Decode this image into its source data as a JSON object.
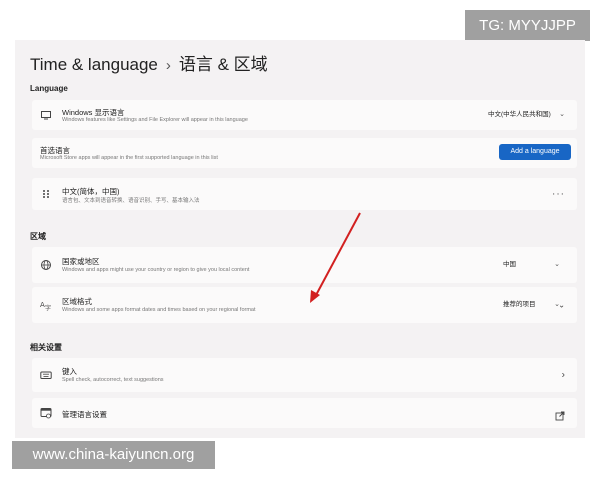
{
  "tg_tag": "TG: MYYJJPP",
  "watermark": "www.china-kaiyuncn.org",
  "title": {
    "parent": "Time & language",
    "separator": "›",
    "current": "语言 & 区域"
  },
  "sections": {
    "language": "Language",
    "region": "区域",
    "related": "相关设置"
  },
  "display_language": {
    "label": "Windows 显示语言",
    "desc": "Windows features like Settings and File Explorer will appear in this language",
    "value": "中文(中华人民共和国)"
  },
  "preferred_languages": {
    "label": "首选语言",
    "desc": "Microsoft Store apps will appear in the first supported language in this list",
    "button": "Add a language"
  },
  "language_item": {
    "label": "中文(简体，中国)",
    "desc": "语言包、文本到语音转换、语音识别、手写、基本输入法",
    "more": "···"
  },
  "country": {
    "label": "国家或地区",
    "desc": "Windows and apps might use your country or region to give you local content",
    "value": "中国"
  },
  "regional_format": {
    "label": "区域格式",
    "desc": "Windows and some apps format dates and times based on your regional format",
    "value": "推荐的项目"
  },
  "typing": {
    "label": "键入",
    "desc": "Spell check, autocorrect, text suggestions"
  },
  "admin_language": {
    "label": "管理语言设置"
  },
  "icons": {
    "display": "monitor-icon",
    "drag": "drag-handle-icon",
    "globe": "globe-icon",
    "format": "regional-format-icon",
    "keyboard": "keyboard-icon",
    "admin": "admin-settings-icon",
    "external": "external-link-icon"
  },
  "colors": {
    "accent": "#1866c5",
    "arrow": "#d22020"
  }
}
